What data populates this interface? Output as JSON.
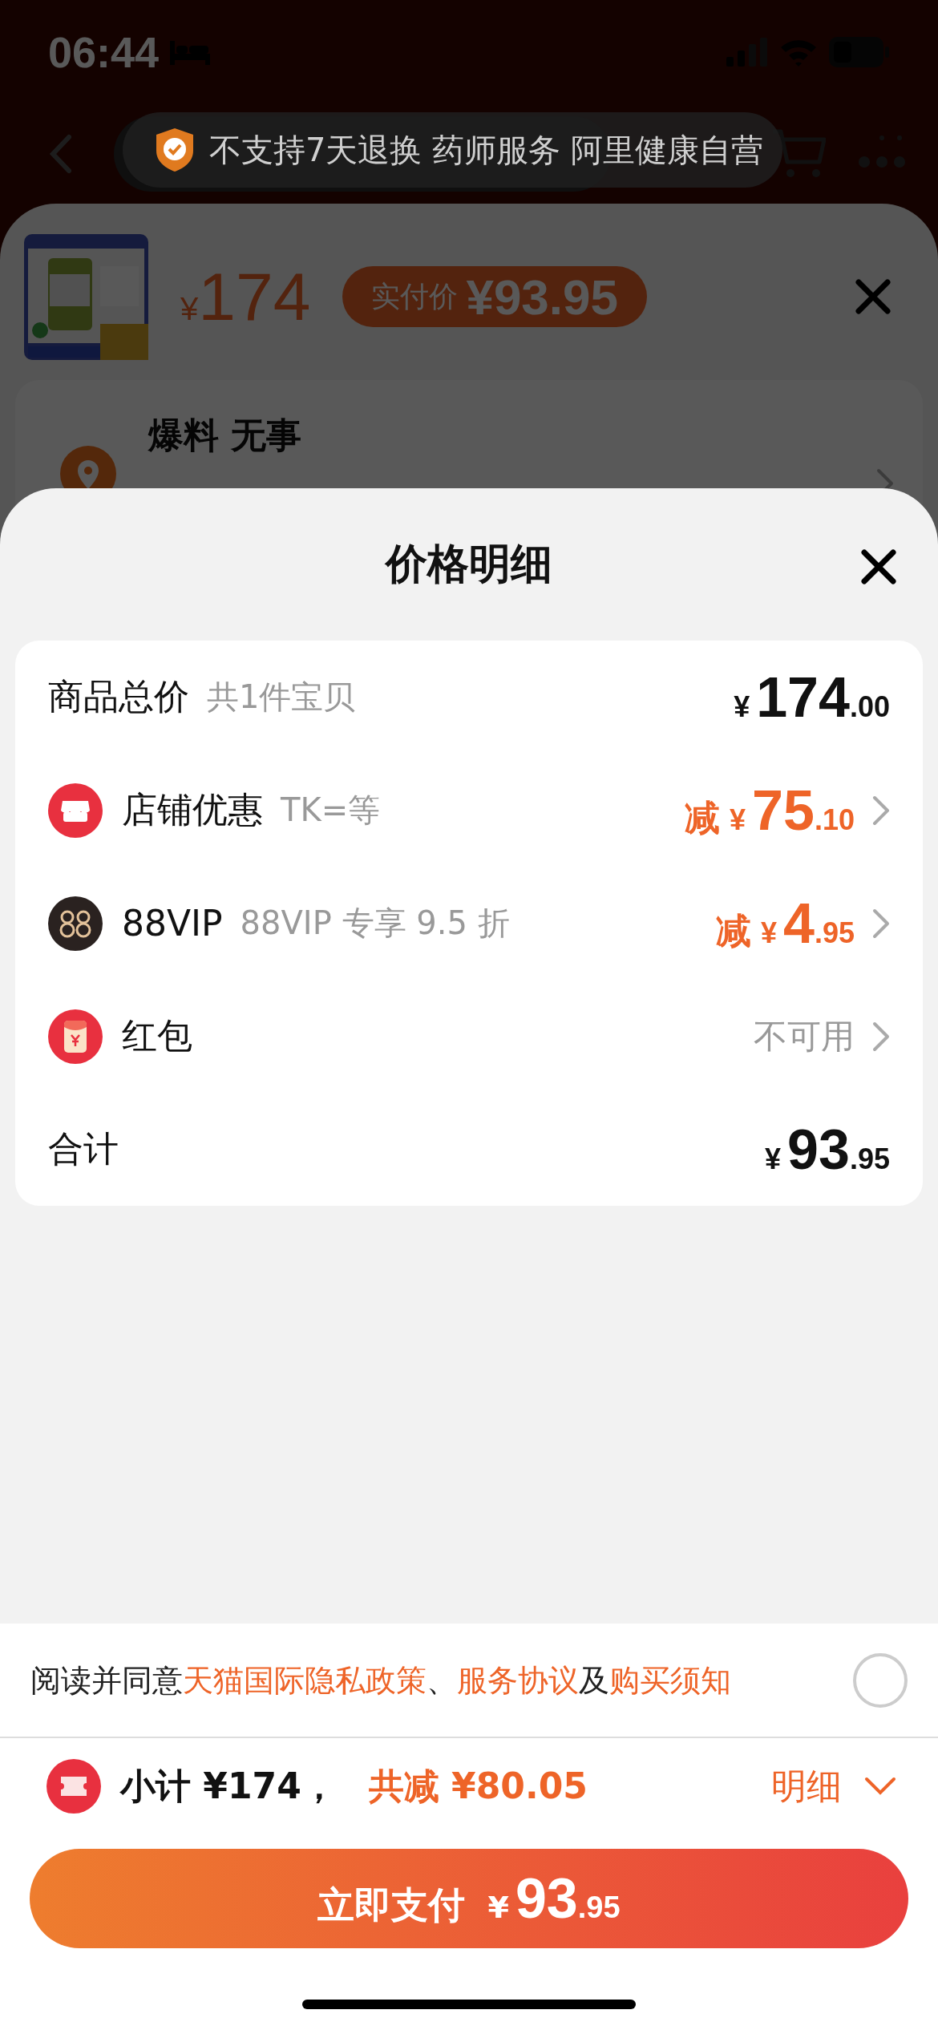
{
  "status_bar": {
    "time": "06:44"
  },
  "nav_bar": {
    "badge": "不支持7天退换 药师服务 阿里健康自营"
  },
  "product": {
    "price_currency": "¥",
    "price": "174",
    "paid_label": "实付价",
    "paid_price": "¥93.95"
  },
  "address": {
    "title": "爆料 无事"
  },
  "price_detail": {
    "title": "价格明细",
    "rows": [
      {
        "kind": "goods",
        "label": "商品总价",
        "note": "共1件宝贝",
        "amount": {
          "currency": "¥",
          "integer": "174",
          "decimal": ".00"
        }
      },
      {
        "kind": "shop",
        "label": "店铺优惠",
        "note": "TK=等",
        "amount": {
          "prefix": "减",
          "currency": "¥",
          "integer": "75",
          "decimal": ".10"
        }
      },
      {
        "kind": "vip",
        "label": "88VIP",
        "note": "88VIP 专享 9.5 折",
        "amount": {
          "prefix": "减",
          "currency": "¥",
          "integer": "4",
          "decimal": ".95"
        }
      },
      {
        "kind": "packet",
        "label": "红包",
        "status": "不可用"
      },
      {
        "kind": "total",
        "label": "合计",
        "amount": {
          "currency": "¥",
          "integer": "93",
          "decimal": ".95"
        }
      }
    ]
  },
  "agreement": {
    "checked": false,
    "parts": [
      {
        "text": "阅读并同意",
        "link": false
      },
      {
        "text": "天猫国际隐私政策",
        "link": true
      },
      {
        "text": "、",
        "link": false
      },
      {
        "text": "服务协议",
        "link": true
      },
      {
        "text": "及",
        "link": false
      },
      {
        "text": "购买须知",
        "link": true
      }
    ]
  },
  "summary": {
    "subtotal": "小计 ¥174，",
    "discount": "共减 ¥80.05",
    "detail": "明细"
  },
  "pay_button": {
    "label": "立即支付",
    "currency": "¥",
    "integer": "93",
    "decimal": ".95"
  }
}
